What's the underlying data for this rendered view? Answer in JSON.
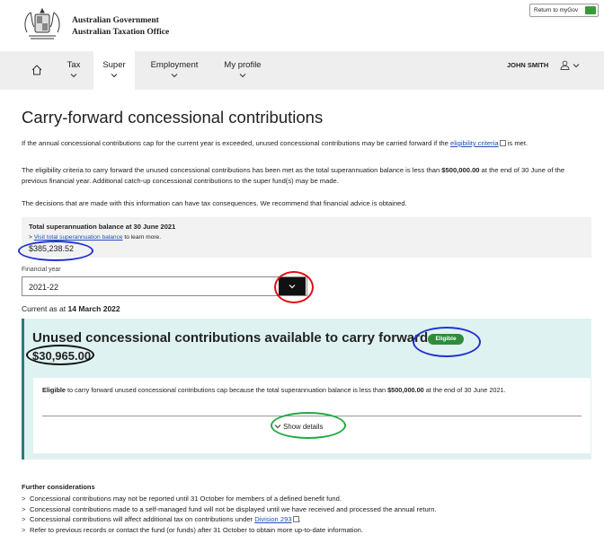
{
  "header": {
    "logo_line1": "Australian Government",
    "logo_line2": "Australian Taxation Office",
    "return_label": "Return to myGov"
  },
  "nav": {
    "items": [
      {
        "label": "Tax"
      },
      {
        "label": "Super"
      },
      {
        "label": "Employment"
      },
      {
        "label": "My profile"
      }
    ],
    "active": "Super",
    "user": "JOHN SMITH"
  },
  "page": {
    "title": "Carry-forward concessional contributions",
    "intro_p1_a": "If the annual concessional contributions cap for the current year is exceeded, unused concessional contributions may be carried forward if the ",
    "intro_p1_link": "eligibility criteria",
    "intro_p1_b": " is met.",
    "intro_p2_a": "The eligibility criteria to carry forward the unused concessional contributions has been met as the total superannuation balance is less than ",
    "intro_p2_bold": "$500,000.00",
    "intro_p2_b": " at the end of 30 June of the previous financial year. Additional catch-up concessional contributions to the super fund(s) may be made.",
    "intro_p3": "The decisions that are made with this information can have tax consequences. We recommend that financial advice is obtained."
  },
  "balance": {
    "title": "Total superannuation balance at 30 June 2021",
    "link_prefix": "> ",
    "link": "Visit total superannuation balance",
    "link_suffix": " to learn more.",
    "value": "$385,238.52"
  },
  "financial_year": {
    "label": "Financial year",
    "value": "2021-22"
  },
  "current_as": {
    "prefix": "Current as at ",
    "date": "14 March 2022"
  },
  "unused": {
    "heading": "Unused concessional contributions available to carry forward",
    "badge": "Eligible",
    "amount": "$30,965.00",
    "card_bold": "Eligible",
    "card_a": " to carry forward unused concessional contributions cap because the total superannuation balance is less than ",
    "card_bold2": "$500,000.00",
    "card_b": " at the end of 30 June 2021.",
    "show_details": "Show details"
  },
  "further": {
    "title": "Further considerations",
    "items": [
      {
        "text": "Concessional contributions may not be reported until 31 October for members of a defined benefit fund."
      },
      {
        "text": "Concessional contributions made to a self-managed fund will not be displayed until we have received and processed the annual return."
      },
      {
        "text_a": "Concessional contributions will affect additional tax on contributions under ",
        "link": "Division 293"
      },
      {
        "text": "Refer to previous records or contact the fund (or funds) after 31 October to obtain more up-to-date information."
      }
    ]
  },
  "colors": {
    "panel_bg": "#dff2f2",
    "panel_accent": "#2a7d7d",
    "badge": "#2e8b3a",
    "link": "#1e50b4",
    "nav_bg": "#eeeeee"
  }
}
